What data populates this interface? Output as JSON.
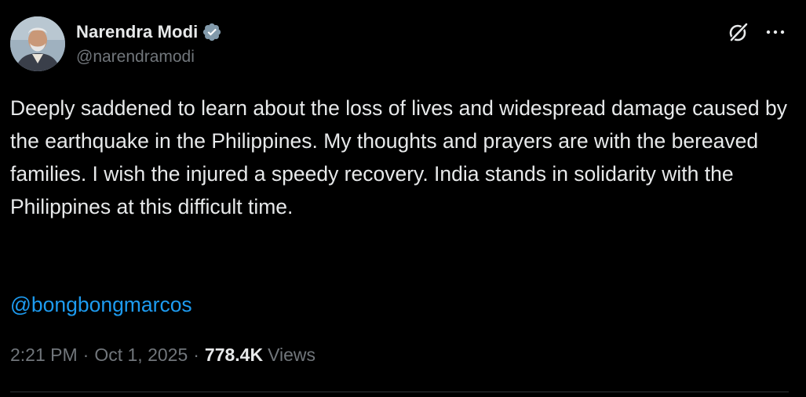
{
  "author": {
    "display_name": "Narendra Modi",
    "handle": "@narendramodi",
    "verified": true
  },
  "tweet": {
    "text": "Deeply saddened to learn about the loss of lives and widespread damage caused by the earthquake in the Philippines. My thoughts and prayers are with the bereaved families. I wish the injured a speedy recovery. India stands in solidarity with the Philippines at this difficult time.",
    "mention": "@bongbongmarcos"
  },
  "meta": {
    "time": "2:21 PM",
    "separator": "·",
    "date": "Oct 1, 2025",
    "views_count": "778.4K",
    "views_label": "Views"
  },
  "icons": {
    "verified": "verified-badge-icon",
    "grok": "grok-icon",
    "more": "more-horizontal-icon"
  },
  "colors": {
    "background": "#000000",
    "text_primary": "#e7e9ea",
    "text_secondary": "#71767b",
    "link": "#1d9bf0",
    "verified_badge": "#829aab",
    "divider": "#2f3336"
  }
}
